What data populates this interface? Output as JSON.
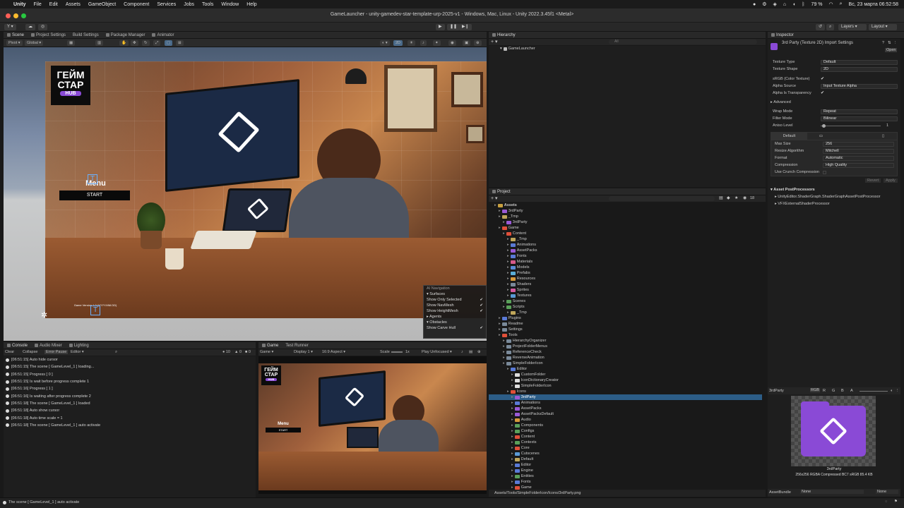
{
  "menubar": {
    "app_name": "Unity",
    "items": [
      "File",
      "Edit",
      "Assets",
      "GameObject",
      "Component",
      "Services",
      "Jobs",
      "Tools",
      "Window",
      "Help"
    ],
    "battery": "79 %",
    "datetime": "Вс, 23 марта  06:52:58"
  },
  "window": {
    "title": "GameLauncher - unity-gamedev-star-template-urp-2025-v1 - Windows, Mac, Linux - Unity 2022.3.45f1 <Metal>"
  },
  "toolbar": {
    "account_label": "Y",
    "layers_label": "Layers",
    "layout_label": "Layout"
  },
  "scene_panel": {
    "tabs": [
      "Scene",
      "Project Settings",
      "Build Settings",
      "Package Manager",
      "Animator"
    ],
    "pivot_label": "Pivot",
    "global_label": "Global",
    "mode_2d": "2D",
    "logo_line1": "ГЕЙМ",
    "logo_line2": "СТАР",
    "logo_hub": "HUB",
    "menu_title": "Menu",
    "start_label": "START",
    "version_text": "Game Version 1.0 (YYYY.MM.DD)",
    "overlay": {
      "title": "AI Navigation",
      "section_surfaces": "Surfaces",
      "rows": [
        "Show Only Selected",
        "Show NavMesh",
        "Show HeightMesh"
      ],
      "section_agents": "Agents",
      "section_obstacles": "Obstacles",
      "carve_hull": "Show Carve Hull"
    }
  },
  "console_panel": {
    "tabs": [
      "Console",
      "Audio Mixer",
      "Lighting"
    ],
    "clear": "Clear",
    "collapse": "Collapse",
    "error_pause": "Error Pause",
    "editor": "Editor",
    "log_count": "10",
    "warn_count": "0",
    "err_count": "0",
    "logs": [
      "[06:51:15] Auto hide cursor",
      "[06:51:15] The scene [ GameLevel_1 ] loading...",
      "[06:51:15] Progress [ 0 ]",
      "[06:51:15] Is wait before progress complete 1",
      "[06:51:16] Progress [ 1 ]",
      "[06:51:16] Is waiting after progress complete 2",
      "[06:51:18] The scene [ GameLevel_1 ] loaded",
      "[06:51:18] Auto show cursor",
      "[06:51:18] Auto time scale = 1",
      "[06:51:18] The scene [ GameLevel_1 ] auto activate"
    ]
  },
  "game_panel": {
    "tabs": [
      "Game",
      "Test Runner"
    ],
    "game_label": "Game",
    "display": "Display 1",
    "aspect": "16:9 Aspect",
    "scale_label": "Scale",
    "scale_value": "1x",
    "play_mode": "Play Unfocused",
    "menu_title": "Menu",
    "start_label": "START"
  },
  "hierarchy": {
    "tab": "Hierarchy",
    "search_placeholder": "All",
    "root": "GameLauncher"
  },
  "project": {
    "tab": "Project",
    "count": "18",
    "path": "Assets/Tools/SimpleFolderIcon/Icons/3rdParty.png",
    "tree": [
      {
        "label": "Assets",
        "depth": 0,
        "color": "#c8a040",
        "bold": true
      },
      {
        "label": "3rdParty",
        "depth": 1,
        "color": "#9a5ad6"
      },
      {
        "label": "_Tmp",
        "depth": 1,
        "color": "#bfa65a"
      },
      {
        "label": "3rdParty",
        "depth": 2,
        "color": "#9a5ad6"
      },
      {
        "label": "Game",
        "depth": 1,
        "color": "#e0503a"
      },
      {
        "label": "Content",
        "depth": 2,
        "color": "#e0503a"
      },
      {
        "label": "_Tmp",
        "depth": 3,
        "color": "#bfa65a"
      },
      {
        "label": "Animations",
        "depth": 3,
        "color": "#5a7ad6"
      },
      {
        "label": "AssetPacks",
        "depth": 3,
        "color": "#9a5ad6"
      },
      {
        "label": "Fonts",
        "depth": 3,
        "color": "#5a7ad6"
      },
      {
        "label": "Materials",
        "depth": 3,
        "color": "#d65a8a"
      },
      {
        "label": "Models",
        "depth": 3,
        "color": "#5a8ad6"
      },
      {
        "label": "Prefabs",
        "depth": 3,
        "color": "#5aaed6"
      },
      {
        "label": "Resources",
        "depth": 3,
        "color": "#d69a3a"
      },
      {
        "label": "Shaders",
        "depth": 3,
        "color": "#7a8a9a"
      },
      {
        "label": "Sprites",
        "depth": 3,
        "color": "#d65aa0"
      },
      {
        "label": "Textures",
        "depth": 3,
        "color": "#5a9ad6"
      },
      {
        "label": "Scenes",
        "depth": 2,
        "color": "#5aa05a"
      },
      {
        "label": "Scripts",
        "depth": 2,
        "color": "#5aa05a"
      },
      {
        "label": "_Tmp",
        "depth": 3,
        "color": "#bfa65a"
      },
      {
        "label": "Plugins",
        "depth": 1,
        "color": "#5a7ad6"
      },
      {
        "label": "Readme",
        "depth": 1,
        "color": "#7a8a9a"
      },
      {
        "label": "Settings",
        "depth": 1,
        "color": "#7a8a9a"
      },
      {
        "label": "Tools",
        "depth": 1,
        "color": "#e0503a"
      },
      {
        "label": "HierarchyOrganizer",
        "depth": 2,
        "color": "#7a8a9a"
      },
      {
        "label": "ProjectFolderMenus",
        "depth": 2,
        "color": "#7a8a9a"
      },
      {
        "label": "ReferenceCheck",
        "depth": 2,
        "color": "#7a8a9a"
      },
      {
        "label": "ReverseAnimation",
        "depth": 2,
        "color": "#7a8a9a"
      },
      {
        "label": "SimpleFolderIcon",
        "depth": 2,
        "color": "#7a8a9a"
      },
      {
        "label": "Editor",
        "depth": 3,
        "color": "#5a7ad6"
      },
      {
        "label": "CustomFolder",
        "depth": 4,
        "color": "#dddddd"
      },
      {
        "label": "IconDictionaryCreator",
        "depth": 4,
        "color": "#dddddd"
      },
      {
        "label": "SimpleFolderIcon",
        "depth": 4,
        "color": "#dddddd"
      },
      {
        "label": "Icons",
        "depth": 3,
        "color": "#e0503a"
      },
      {
        "label": "3rdParty",
        "depth": 4,
        "color": "#9a5ad6",
        "selected": true
      },
      {
        "label": "Animations",
        "depth": 4,
        "color": "#5a7ad6"
      },
      {
        "label": "AssetPacks",
        "depth": 4,
        "color": "#9a5ad6"
      },
      {
        "label": "AssetPacksDefault",
        "depth": 4,
        "color": "#9a5ad6"
      },
      {
        "label": "Audio",
        "depth": 4,
        "color": "#d69a3a"
      },
      {
        "label": "Components",
        "depth": 4,
        "color": "#5aa05a"
      },
      {
        "label": "Configs",
        "depth": 4,
        "color": "#5aa05a"
      },
      {
        "label": "Content",
        "depth": 4,
        "color": "#e0503a"
      },
      {
        "label": "Contexts",
        "depth": 4,
        "color": "#5aa05a"
      },
      {
        "label": "Core",
        "depth": 4,
        "color": "#e0503a"
      },
      {
        "label": "Cutscenes",
        "depth": 4,
        "color": "#5a9ad6"
      },
      {
        "label": "Default",
        "depth": 4,
        "color": "#bfa65a"
      },
      {
        "label": "Editor",
        "depth": 4,
        "color": "#5a7ad6"
      },
      {
        "label": "Engine",
        "depth": 4,
        "color": "#5a7ad6"
      },
      {
        "label": "Entities",
        "depth": 4,
        "color": "#5aa05a"
      },
      {
        "label": "Fonts",
        "depth": 4,
        "color": "#5a7ad6"
      },
      {
        "label": "Game",
        "depth": 4,
        "color": "#e0503a"
      }
    ]
  },
  "inspector": {
    "tab": "Inspector",
    "header": "3rd Party (Texture 2D) Import Settings",
    "open_label": "Open",
    "props": [
      {
        "label": "Texture Type",
        "value": "Default"
      },
      {
        "label": "Texture Shape",
        "value": "2D"
      }
    ],
    "srgb_label": "sRGB (Color Texture)",
    "alpha_source_label": "Alpha Source",
    "alpha_source_value": "Input Texture Alpha",
    "alpha_transparency_label": "Alpha Is Transparency",
    "advanced_label": "Advanced",
    "wrap_label": "Wrap Mode",
    "wrap_value": "Repeat",
    "filter_label": "Filter Mode",
    "filter_value": "Bilinear",
    "aniso_label": "Aniso Level",
    "aniso_value": "1",
    "platform_default": "Default",
    "max_size_label": "Max Size",
    "max_size_value": "256",
    "resize_label": "Resize Algorithm",
    "resize_value": "Mitchell",
    "format_label": "Format",
    "format_value": "Automatic",
    "compression_label": "Compression",
    "compression_value": "High Quality",
    "crunch_label": "Use Crunch Compression",
    "revert_label": "Revert",
    "apply_label": "Apply",
    "postproc_title": "Asset PostProcessors",
    "postproc_items": [
      "UnityEditor.ShaderGraph.ShaderGraphAssetPostProcessor",
      "VFXExternalShaderProcessor"
    ],
    "preview_name": "3rdParty",
    "preview_channels": [
      "RGB",
      "R",
      "G",
      "B",
      "A"
    ],
    "preview_caption_name": "3rdParty",
    "preview_caption_info": "256x256  RGBA Compressed BC7 sRGB  85.4 KB",
    "assetbundle_label": "AssetBundle",
    "assetbundle_value": "None",
    "assetbundle_variant": "None"
  },
  "status": {
    "message": "The scene [ GameLevel_1 ] auto activate"
  },
  "colors": {
    "selection": "#2c5d87",
    "unity_purple": "#8a4ad6"
  }
}
